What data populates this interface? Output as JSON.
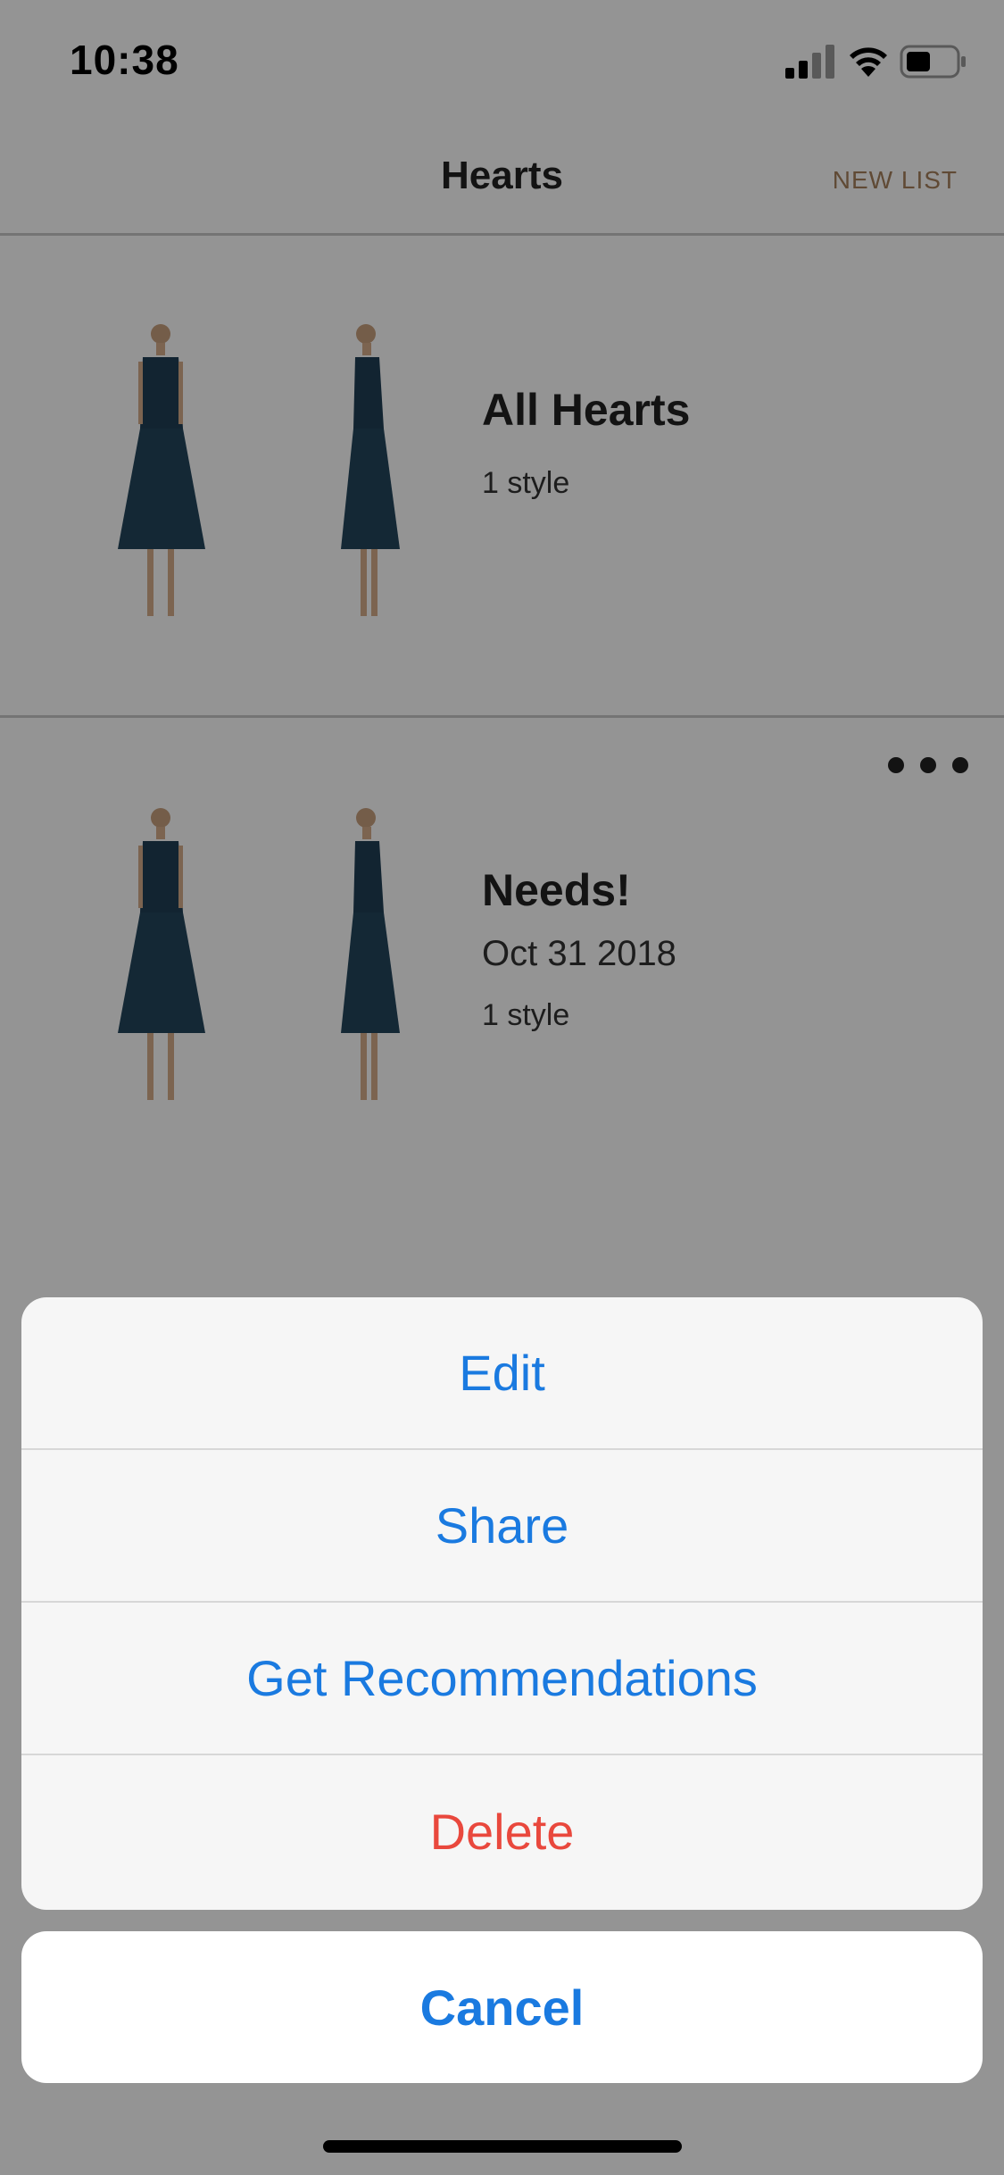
{
  "status_bar": {
    "time": "10:38"
  },
  "nav": {
    "title": "Hearts",
    "new_list_label": "NEW LIST"
  },
  "lists": [
    {
      "title": "All Hearts",
      "date": "",
      "count": "1 style"
    },
    {
      "title": "Needs!",
      "date": "Oct 31 2018",
      "count": "1 style"
    }
  ],
  "action_sheet": {
    "items": [
      {
        "label": "Edit"
      },
      {
        "label": "Share"
      },
      {
        "label": "Get Recommendations"
      },
      {
        "label": "Delete"
      }
    ],
    "cancel_label": "Cancel"
  },
  "colors": {
    "action_blue": "#1a7ae0",
    "destructive_red": "#e9483d",
    "accent_gold": "#a5805c",
    "dress_navy": "#1f3f55"
  },
  "icons": {
    "signal": "signal-icon",
    "wifi": "wifi-icon",
    "battery": "battery-icon",
    "more": "more-horizontal-icon"
  }
}
